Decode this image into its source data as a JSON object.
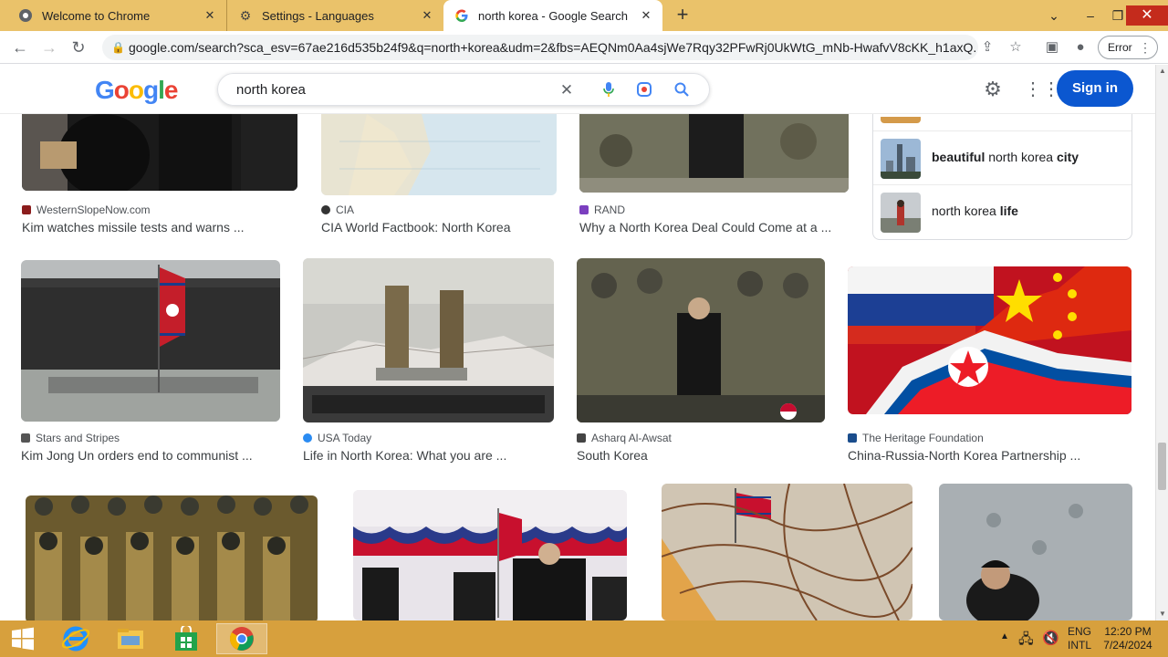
{
  "browser": {
    "tabs": [
      {
        "title": "Welcome to Chrome",
        "active": false
      },
      {
        "title": "Settings - Languages",
        "active": false
      },
      {
        "title": "north korea - Google Search",
        "active": true
      }
    ],
    "url": "google.com/search?sca_esv=67ae216d535b24f9&q=north+korea&udm=2&fbs=AEQNm0Aa4sjWe7Rqy32PFwRj0UkWtG_mNb-HwafvV8cKK_h1axQ...",
    "profile_button": "Error"
  },
  "search": {
    "query": "north korea",
    "sign_in": "Sign in"
  },
  "related_searches": [
    {
      "segments": [
        {
          "t": "beautiful",
          "b": true
        },
        {
          "t": " north korea ",
          "b": false
        },
        {
          "t": "city",
          "b": true
        }
      ]
    },
    {
      "segments": [
        {
          "t": "north korea ",
          "b": false
        },
        {
          "t": "life",
          "b": true
        }
      ]
    }
  ],
  "results": {
    "row1": [
      {
        "source": "WesternSlopeNow.com",
        "title": "Kim watches missile tests and warns ...",
        "icon_color": "#8b1c1c"
      },
      {
        "source": "CIA",
        "title": "CIA World Factbook: North Korea",
        "icon_color": "#333333"
      },
      {
        "source": "RAND",
        "title": "Why a North Korea Deal Could Come at a ...",
        "icon_color": "#7b3fbf"
      }
    ],
    "row2": [
      {
        "source": "Stars and Stripes",
        "title": "Kim Jong Un orders end to communist ...",
        "icon_color": "#555555"
      },
      {
        "source": "USA Today",
        "title": "Life in North Korea: What you are ...",
        "icon_color": "#2a8bf2"
      },
      {
        "source": "Asharq Al-Awsat",
        "title": "South Korea",
        "icon_color": "#444444"
      },
      {
        "source": "The Heritage Foundation",
        "title": "China-Russia-North Korea Partnership ...",
        "icon_color": "#1a4d8c"
      }
    ]
  },
  "taskbar": {
    "lang_line1": "ENG",
    "lang_line2": "INTL",
    "time": "12:20 PM",
    "date": "7/24/2024"
  }
}
